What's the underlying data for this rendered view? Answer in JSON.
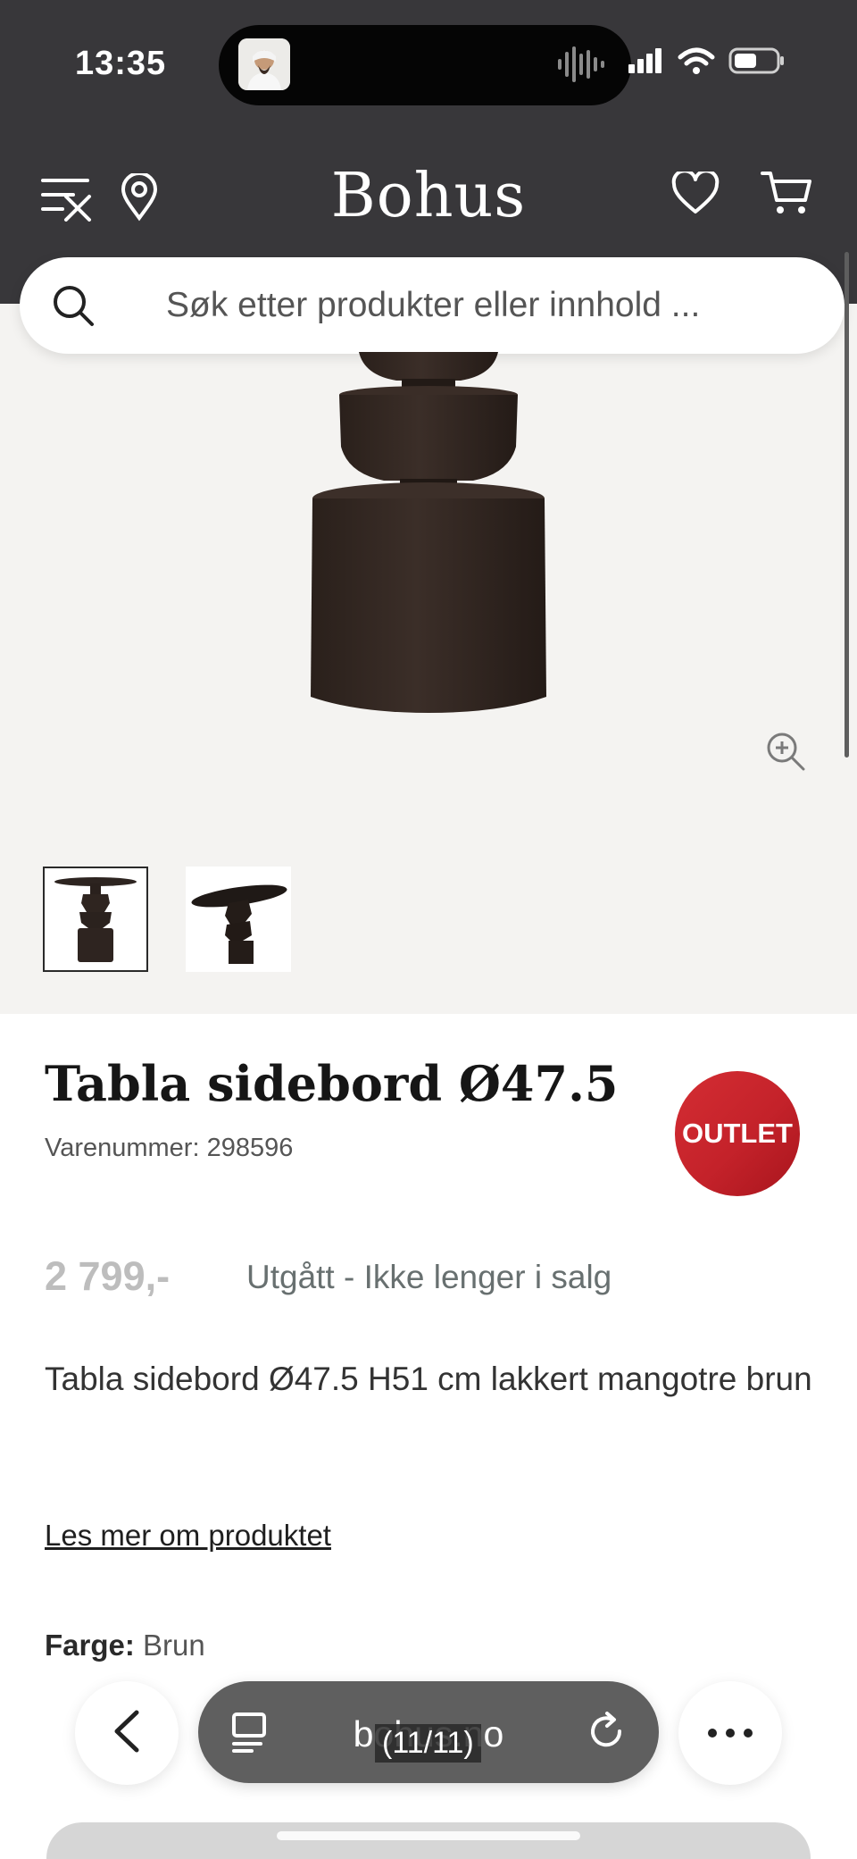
{
  "status_bar": {
    "time": "13:35"
  },
  "header": {
    "brand": "Bohus",
    "search_placeholder": "Søk etter produkter eller innhold ..."
  },
  "icons": {
    "menu": "menu-close-icon",
    "location": "location-pin-icon",
    "favorite": "heart-icon",
    "cart": "cart-icon",
    "search": "search-icon",
    "zoom": "zoom-in-icon"
  },
  "product": {
    "title": "Tabla sidebord Ø47.5",
    "sku": "Varenummer: 298596",
    "badge": "OUTLET",
    "price": "2 799,-",
    "availability": "Utgått - Ikke lenger i salg",
    "description": "Tabla sidebord Ø47.5 H51 cm lakkert mangotre brun",
    "read_more": "Les mer om produktet",
    "color_label": "Farge:",
    "color_value": "Brun"
  },
  "browser": {
    "url": "bohus.no",
    "page_counter": "(11/11)"
  },
  "colors": {
    "header_bg": "#38373a",
    "outlet_red": "#c4222a",
    "page_bg": "#f4f3f1",
    "wood": "#2e2420"
  }
}
